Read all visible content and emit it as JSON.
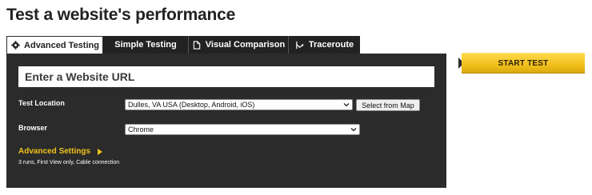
{
  "page": {
    "title": "Test a website's performance"
  },
  "tabs": [
    {
      "label": "Advanced Testing",
      "icon": "gear-icon",
      "active": true
    },
    {
      "label": "Simple Testing",
      "icon": "",
      "active": false
    },
    {
      "label": "Visual Comparison",
      "icon": "document-icon",
      "active": false
    },
    {
      "label": "Traceroute",
      "icon": "route-icon",
      "active": false
    }
  ],
  "form": {
    "url_placeholder": "Enter a Website URL",
    "location_label": "Test Location",
    "location_value": "Dulles, VA USA (Desktop, Android, iOS)",
    "map_button_label": "Select from Map",
    "browser_label": "Browser",
    "browser_value": "Chrome",
    "advanced_link": "Advanced Settings",
    "advanced_summary": "3 runs, First View only, Cable connection"
  },
  "start_button": {
    "label": "START TEST"
  },
  "colors": {
    "accent": "#f0c21a",
    "panel": "#2b2b2b",
    "tab_bg": "#222222"
  }
}
